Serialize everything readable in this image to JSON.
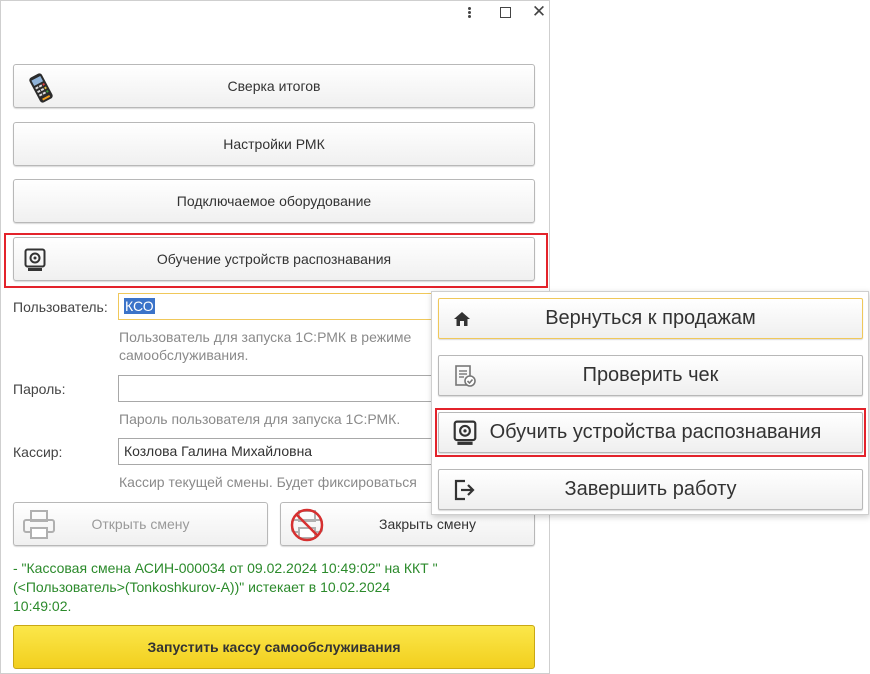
{
  "window": {
    "menu_label": "⋮",
    "maximize_label": "",
    "close_label": "✕"
  },
  "buttons": {
    "reconciliation": "Сверка итогов",
    "rmk_settings": "Настройки РМК",
    "equipment": "Подключаемое оборудование",
    "train_recognition": "Обучение устройств распознавания"
  },
  "form": {
    "user_label": "Пользователь:",
    "user_value": "КСО",
    "user_hint_line1": "Пользователь для запуска 1С:РМК в режиме",
    "user_hint_line2": "самообслуживания.",
    "password_label": "Пароль:",
    "password_value": "",
    "password_hint": "Пароль пользователя для запуска 1С:РМК.",
    "cashier_label": "Кассир:",
    "cashier_value": "Козлова Галина Михайловна",
    "cashier_hint": "Кассир текущей смены. Будет фиксироваться"
  },
  "shift": {
    "open_label": "Открыть смену",
    "close_label": "Закрыть смену"
  },
  "message": {
    "line1": "- \"Кассовая смена АСИН-000034 от 09.02.2024 10:49:02\" на ККТ \"",
    "line2": "(<Пользователь>(Tonkoshkurov-A))\" истекает в 10.02.2024",
    "line3": "10:49:02."
  },
  "launch_label": "Запустить кассу самообслуживания",
  "popup": {
    "items": [
      {
        "label": "Вернуться к продажам",
        "icon": "home-icon"
      },
      {
        "label": "Проверить чек",
        "icon": "receipt-check-icon"
      },
      {
        "label": "Обучить устройства распознавания",
        "icon": "camera-icon"
      },
      {
        "label": "Завершить работу",
        "icon": "exit-icon"
      }
    ]
  },
  "colors": {
    "highlight": "#e3232b",
    "accent_yellow": "#f2cf1e",
    "message_green": "#2b8a2b",
    "selection_blue": "#3b73c9"
  }
}
